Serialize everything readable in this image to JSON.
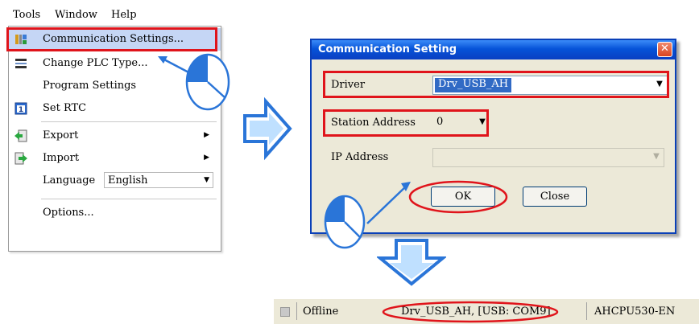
{
  "menubar": {
    "items": [
      "Tools",
      "Window",
      "Help"
    ],
    "mnemonics": [
      "T",
      "W",
      "H"
    ]
  },
  "tools_menu": {
    "items": [
      {
        "label": "Communication Settings...",
        "icon": "comm-settings-icon"
      },
      {
        "label": "Change PLC Type...",
        "icon": "plc-type-icon"
      },
      {
        "label": "Program Settings",
        "icon": ""
      },
      {
        "label": "Set RTC",
        "icon": "rtc-calendar-icon"
      },
      {
        "label": "Export",
        "icon": "export-icon"
      },
      {
        "label": "Import",
        "icon": "import-icon"
      },
      {
        "label": "Language",
        "icon": ""
      },
      {
        "label": "Options...",
        "icon": ""
      }
    ],
    "language_value": "English",
    "highlight_color": "#e0141b"
  },
  "dialog": {
    "title": "Communication Setting",
    "driver_label": "Driver",
    "driver_value": "Drv_USB_AH",
    "station_label": "Station Address",
    "station_value": "0",
    "ip_label": "IP Address",
    "ip_value": "",
    "ok_label": "OK",
    "close_label": "Close"
  },
  "statusbar": {
    "state": "Offline",
    "connection": "Drv_USB_AH, [USB: COM9]",
    "plc_model": "AHCPU530-EN"
  },
  "colors": {
    "callout_red": "#e0141b",
    "arrow_blue": "#3a8ee6",
    "titlebar_blue": "#0653d8"
  }
}
